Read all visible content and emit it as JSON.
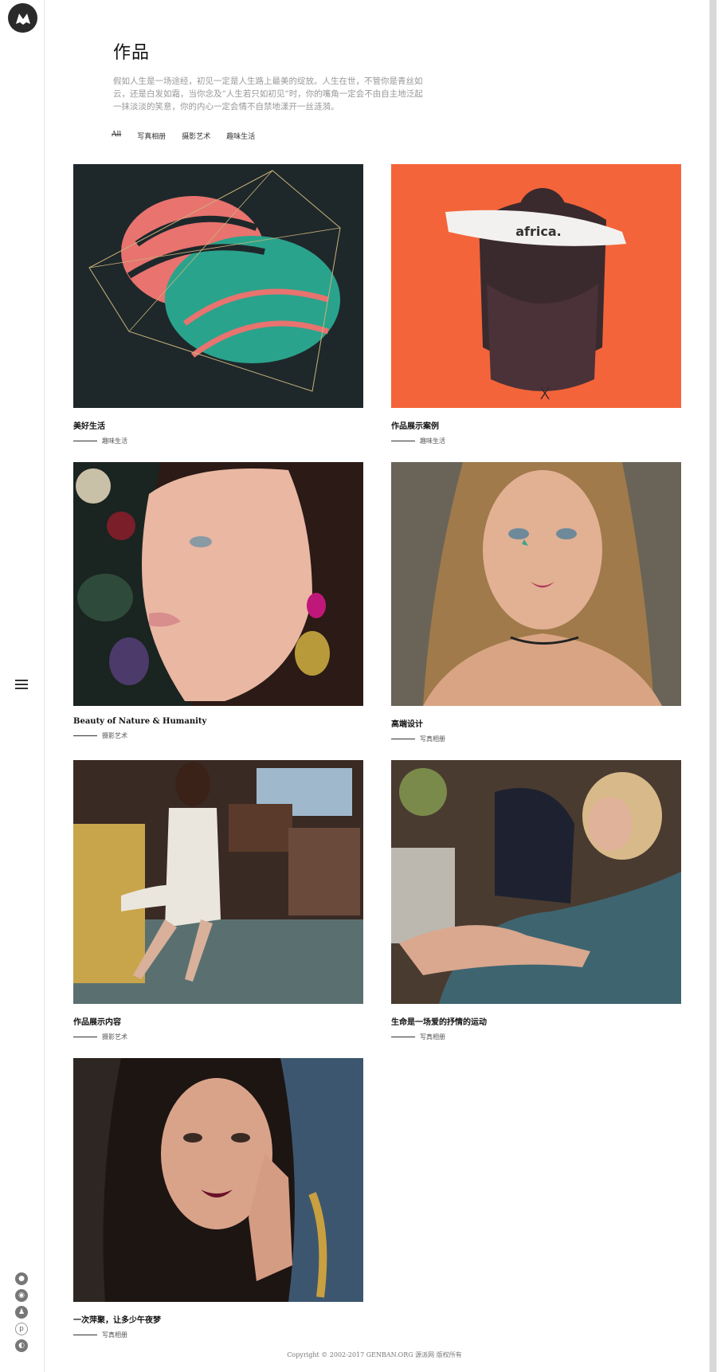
{
  "header": {
    "title": "作品",
    "intro": "假如人生是一场途经，初见一定是人生路上最美的绽放。人生在世，不管你是青丝如云，还是白发如霜，当你念及“人生若只如初见”时，你的嘴角一定会不由自主地泛起一抹淡淡的笑意，你的内心一定会情不自禁地漾开一丝涟漪。"
  },
  "filters": [
    "All",
    "写真相册",
    "摄影艺术",
    "趣味生活"
  ],
  "cards": [
    {
      "title": "美好生活",
      "category": "趣味生活"
    },
    {
      "title": "作品展示案例",
      "category": "趣味生活"
    },
    {
      "title": "Beauty of Nature & Humanity",
      "category": "摄影艺术"
    },
    {
      "title": "高端设计",
      "category": "写真相册"
    },
    {
      "title": "作品展示内容",
      "category": "摄影艺术"
    },
    {
      "title": "生命是一场爱的抒情的运动",
      "category": "写真相册"
    },
    {
      "title": "一次萍聚，让多少午夜梦",
      "category": "写真相册"
    }
  ],
  "africa_label": "africa.",
  "footer": "Copyright © 2002-2017 GENBAN.ORG 源派网 版权所有",
  "colors": {
    "accent_orange": "#f0643a",
    "dark_bg": "#1f2a2e"
  }
}
